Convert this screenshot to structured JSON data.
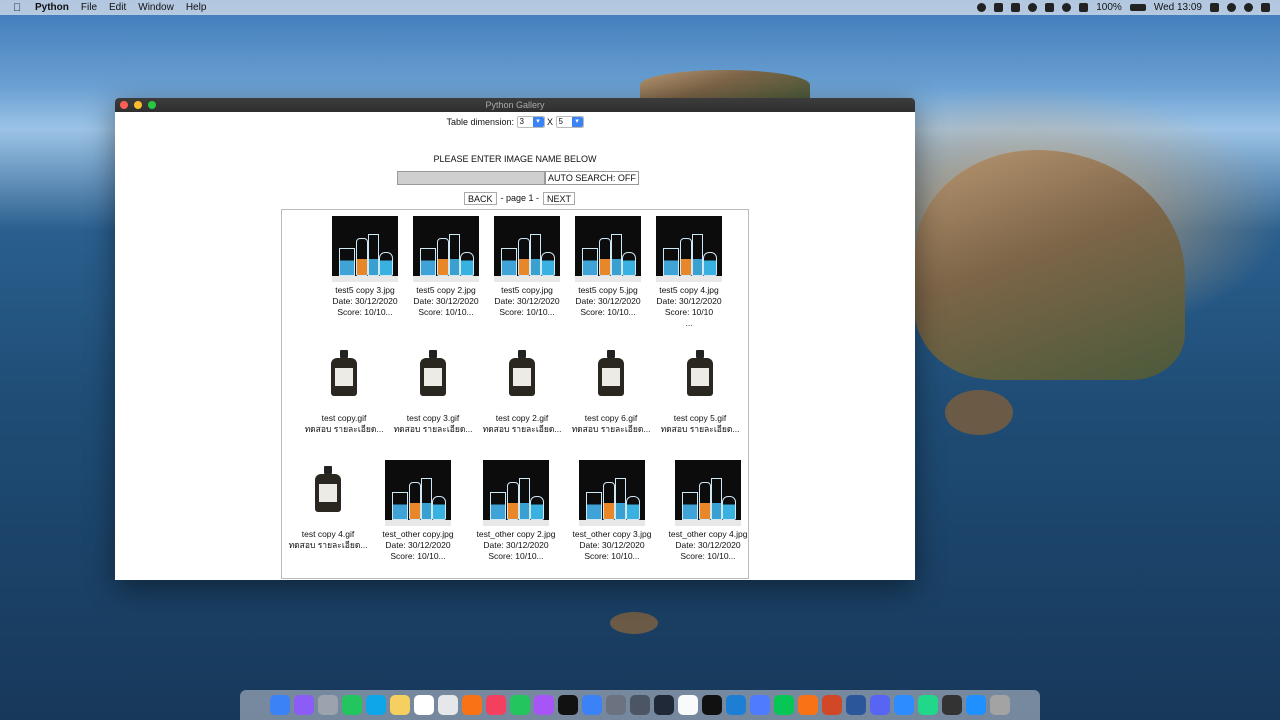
{
  "menubar": {
    "app_name": "Python",
    "items": [
      "File",
      "Edit",
      "Window",
      "Help"
    ],
    "battery": "100%",
    "clock": "Wed 13:09"
  },
  "window": {
    "title": "Python Gallery"
  },
  "controls": {
    "dimension_label": "Table dimension:",
    "rows_value": "3",
    "separator": "X",
    "cols_value": "5",
    "instruction": "PLEASE ENTER IMAGE NAME BELOW",
    "search_value": "",
    "auto_search_label": "AUTO SEARCH: OFF",
    "back_label": "BACK",
    "page_label": "- page 1 -",
    "next_label": "NEXT"
  },
  "gallery": {
    "items": [
      {
        "type": "flask",
        "name": "test5 copy 3.jpg",
        "line2": "Date: 30/12/2020",
        "line3": "Score: 10/10...",
        "line4": ""
      },
      {
        "type": "flask",
        "name": "test5 copy 2.jpg",
        "line2": "Date: 30/12/2020",
        "line3": "Score: 10/10...",
        "line4": ""
      },
      {
        "type": "flask",
        "name": "test5 copy.jpg",
        "line2": "Date: 30/12/2020",
        "line3": "Score: 10/10...",
        "line4": ""
      },
      {
        "type": "flask",
        "name": "test5 copy 5.jpg",
        "line2": "Date: 30/12/2020",
        "line3": "Score: 10/10...",
        "line4": ""
      },
      {
        "type": "flask",
        "name": "test5 copy 4.jpg",
        "line2": "Date: 30/12/2020",
        "line3": "Score: 10/10",
        "line4": "..."
      },
      {
        "type": "bottle",
        "name": "test copy.gif",
        "line2": "ทดสอบ รายละเอียด...",
        "line3": "",
        "line4": ""
      },
      {
        "type": "bottle",
        "name": "test copy 3.gif",
        "line2": "ทดสอบ รายละเอียด...",
        "line3": "",
        "line4": ""
      },
      {
        "type": "bottle",
        "name": "test copy 2.gif",
        "line2": "ทดสอบ รายละเอียด...",
        "line3": "",
        "line4": ""
      },
      {
        "type": "bottle",
        "name": "test copy 6.gif",
        "line2": "ทดสอบ รายละเอียด...",
        "line3": "",
        "line4": ""
      },
      {
        "type": "bottle",
        "name": "test copy 5.gif",
        "line2": "ทดสอบ รายละเอียด...",
        "line3": "",
        "line4": ""
      },
      {
        "type": "bottle",
        "name": "test copy 4.gif",
        "line2": "ทดสอบ รายละเอียด...",
        "line3": "",
        "line4": ""
      },
      {
        "type": "flask",
        "name": "test_other copy.jpg",
        "line2": "Date: 30/12/2020",
        "line3": "Score: 10/10...",
        "line4": ""
      },
      {
        "type": "flask",
        "name": "test_other copy 2.jpg",
        "line2": "Date: 30/12/2020",
        "line3": "Score: 10/10...",
        "line4": ""
      },
      {
        "type": "flask",
        "name": "test_other copy 3.jpg",
        "line2": "Date: 30/12/2020",
        "line3": "Score: 10/10...",
        "line4": ""
      },
      {
        "type": "flask",
        "name": "test_other copy 4.jpg",
        "line2": "Date: 30/12/2020",
        "line3": "Score: 10/10...",
        "line4": ""
      }
    ]
  },
  "dock": {
    "icons": [
      "finder-icon",
      "siri-icon",
      "launchpad-icon",
      "maps-icon",
      "safari-icon",
      "notes-icon",
      "calendar-icon",
      "textedit-icon",
      "preview-icon",
      "photos-icon",
      "messages-icon",
      "podcasts-icon",
      "appletv-icon",
      "appstore-icon",
      "systemprefs-icon",
      "activity-icon",
      "steam-icon",
      "chrome-icon",
      "terminal-icon",
      "vscode-icon",
      "messenger-icon",
      "line-icon",
      "vlc-icon",
      "powerpoint-icon",
      "word-icon",
      "discord-icon",
      "zoom-icon",
      "pycharm-icon",
      "stocks-icon",
      "downloads-icon",
      "trash-icon"
    ],
    "colors": [
      "#3b82f6",
      "#8b5cf6",
      "#9ca3af",
      "#22c55e",
      "#0ea5e9",
      "#f5d061",
      "#ffffff",
      "#e5e7eb",
      "#f97316",
      "#f43f5e",
      "#22c55e",
      "#a855f7",
      "#111111",
      "#3b82f6",
      "#6b7280",
      "#4b5563",
      "#1f2937",
      "#f8fafc",
      "#111111",
      "#1d7fd4",
      "#4f7cff",
      "#06c755",
      "#f97316",
      "#d24726",
      "#2b579a",
      "#5865f2",
      "#2d8cff",
      "#21d789",
      "#333333",
      "#1e90ff",
      "#a3a3a3"
    ]
  }
}
